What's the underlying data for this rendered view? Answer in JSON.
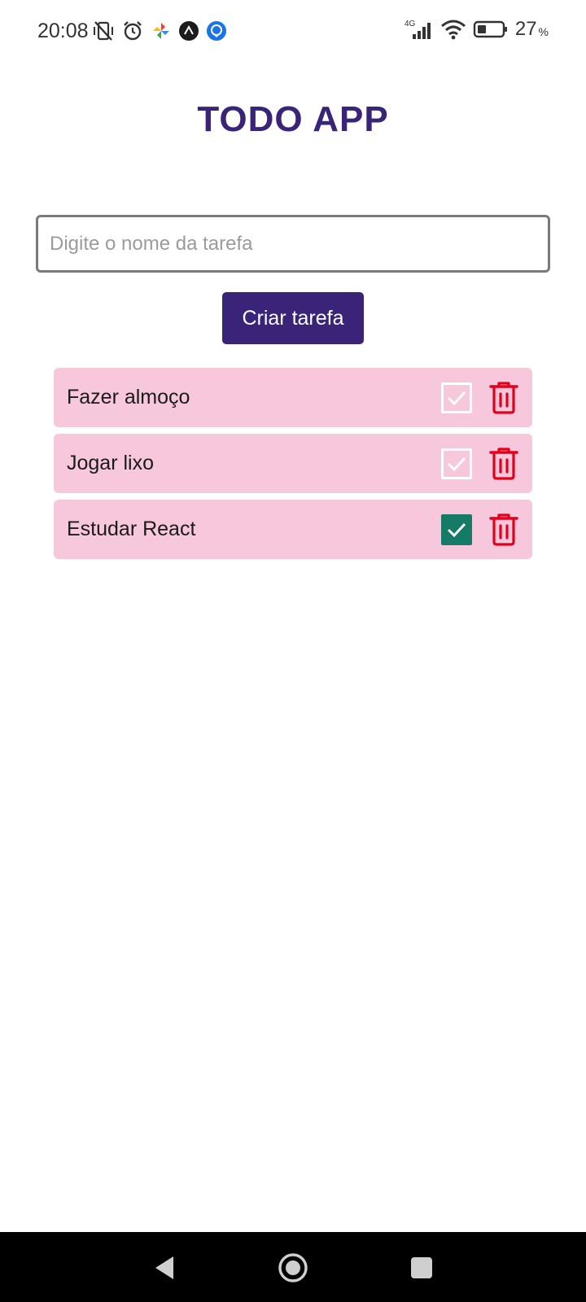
{
  "status_bar": {
    "time": "20:08",
    "network": "4G",
    "battery": "27",
    "battery_unit": "%",
    "icons_left": [
      "vibrate-off-icon",
      "alarm-icon",
      "pinwheel-app-icon",
      "dark-app-icon",
      "blue-app-icon"
    ],
    "icons_right": [
      "signal-icon",
      "wifi-icon",
      "battery-icon"
    ]
  },
  "app": {
    "title": "TODO APP",
    "input": {
      "value": "",
      "placeholder": "Digite o nome da tarefa"
    },
    "create_button_label": "Criar tarefa"
  },
  "tasks": [
    {
      "label": "Fazer almoço",
      "done": false
    },
    {
      "label": "Jogar lixo",
      "done": false
    },
    {
      "label": "Estudar React",
      "done": true
    }
  ],
  "colors": {
    "title": "#3a2479",
    "button_bg": "#3a2479",
    "task_bg": "#f7c8dc",
    "checked_bg": "#157a66",
    "delete_icon": "#e3001b",
    "input_border": "#7a7a7a"
  },
  "nav_bar": {
    "buttons": [
      "back-icon",
      "home-icon",
      "recents-icon"
    ]
  }
}
